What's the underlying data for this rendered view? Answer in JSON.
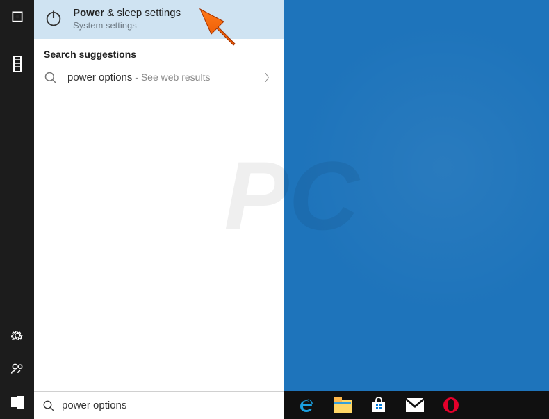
{
  "best_match": {
    "title_bold": "Power",
    "title_rest": " & sleep settings",
    "subtitle": "System settings"
  },
  "section_header": "Search suggestions",
  "suggestion": {
    "text": "power options",
    "extra": " - See web results"
  },
  "search": {
    "value": "power options"
  }
}
